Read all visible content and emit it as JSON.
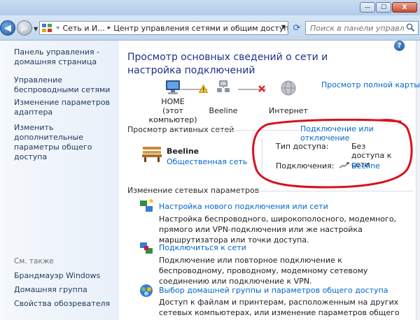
{
  "window": {
    "minimize_label": "—",
    "maximize_label": "☐",
    "close_label": "X"
  },
  "address": {
    "crumbs": [
      "Сеть и И...",
      "Центр управления сетями и общим доступом"
    ]
  },
  "search": {
    "placeholder": "Поиск в панели управления"
  },
  "leftpane": {
    "links": [
      "Панель управления - домашняя страница",
      "Управление беспроводными сетями",
      "Изменение параметров адаптера",
      "Изменить дополнительные параметры общего доступа"
    ],
    "see_also_title": "См. также",
    "see_also": [
      "Брандмауэр Windows",
      "Домашняя группа",
      "Свойства обозревателя"
    ]
  },
  "main": {
    "title": "Просмотр основных сведений о сети и настройка подключений",
    "full_map_link": "Просмотр полной карты",
    "map": {
      "home_label": "HOME",
      "home_sub": "(этот компьютер)",
      "network_label": "Beeline",
      "internet_label": "Интернет"
    },
    "active": {
      "title": "Просмотр активных сетей",
      "connect_link": "Подключение или отключение",
      "network_name": "Beeline",
      "network_type": "Общественная сеть",
      "access_label": "Тип доступа:",
      "access_value": "Без доступа к сети",
      "connections_label": "Подключения:",
      "connections_value": "Beeline"
    },
    "change": {
      "title": "Изменение сетевых параметров",
      "tasks": [
        {
          "link": "Настройка нового подключения или сети",
          "desc": "Настройка беспроводного, широкополосного, модемного, прямого или VPN-подключения или же настройка маршрутизатора или точки доступа."
        },
        {
          "link": "Подключиться к сети",
          "desc": "Подключение или повторное подключение к беспроводному, проводному, модемному сетевому соединению или подключение к VPN."
        },
        {
          "link": "Выбор домашней группы и параметров общего доступа",
          "desc": "Доступ к файлам и принтерам, расположенным на других сетевых компьютерах, или изменение параметров общего доступа."
        }
      ]
    }
  },
  "colors": {
    "link": "#0066cc",
    "title": "#1e3287",
    "annotation_red": "#d8121e"
  }
}
